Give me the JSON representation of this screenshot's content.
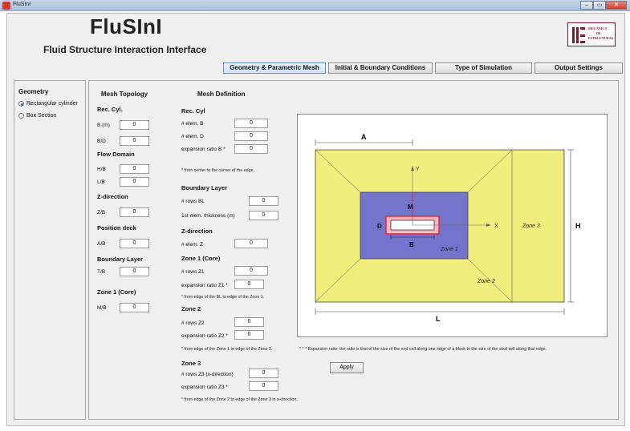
{
  "window": {
    "title": "FluSInI",
    "controls": [
      "–",
      "▭",
      "✕"
    ]
  },
  "header": {
    "title": "FluSInI",
    "subtitle": "Fluid Structure Interaction Interface",
    "logo": {
      "line1": "MECÁNICA",
      "line2": "DE",
      "line3": "ESTRUCTURAS"
    }
  },
  "tabs": [
    {
      "label": "Geometry & Parametric Mesh",
      "active": true
    },
    {
      "label": "Initial & Boundary Conditions",
      "active": false
    },
    {
      "label": "Type of Simulation",
      "active": false
    },
    {
      "label": "Output Settings",
      "active": false
    }
  ],
  "geometry": {
    "title": "Geometry",
    "options": [
      {
        "label": "Rectangular cylinder",
        "selected": true
      },
      {
        "label": "Box Section",
        "selected": false
      }
    ]
  },
  "mesh_topology": {
    "title": "Mesh Topology",
    "rec_cyl": "Rec. Cyl.",
    "b_label": "B (m)",
    "b_value": "0",
    "bd_label": "B/D",
    "bd_value": "0",
    "flow_domain": "Flow Domain",
    "hb_label": "H/B",
    "hb_value": "0",
    "lb_label": "L/B",
    "lb_value": "0",
    "z_direction": "Z-direction",
    "zb_label": "Z/B",
    "zb_value": "0",
    "position_deck": "Position deck",
    "ab_label": "A/B",
    "ab_value": "0",
    "boundary_layer": "Boundary Layer",
    "tb_label": "T/B",
    "tb_value": "0",
    "zone1_core": "Zone 1 (Core)",
    "mb_label": "M/B",
    "mb_value": "0"
  },
  "mesh_definition": {
    "title": "Mesh Definition",
    "rec_cyl": "Rec. Cyl",
    "elem_b_label": "# elem. B",
    "elem_b_value": "0",
    "elem_d_label": "# elem. D",
    "elem_d_value": "0",
    "exp_b_label": "expansion ratio B *",
    "exp_b_value": "0",
    "note_b": "* from center to the corner of the edge.",
    "boundary_layer": "Boundary Layer",
    "rows_bl_label": "# rows BL",
    "rows_bl_value": "0",
    "first_elem_label": "1st elem. thickness (m)",
    "first_elem_value": "0",
    "z_direction": "Z-direction",
    "elem_z_label": "# elem. Z",
    "elem_z_value": "0",
    "zone1": "Zone 1 (Core)",
    "rows_z1_label": "# rows Z1",
    "rows_z1_value": "0",
    "exp_z1_label": "expansion ratio Z1 *",
    "exp_z1_value": "0",
    "note_z1": "* from edge of the BL to edge of the Zone 1.",
    "zone2": "Zone 2",
    "rows_z2_label": "# rows Z2",
    "rows_z2_value": "0",
    "exp_z2_label": "expansion ratio Z2 *",
    "exp_z2_value": "0",
    "note_z2": "* from edge of the Zone 1 to edge of the Zone 2.",
    "zone3": "Zone 3",
    "rows_z3_label": "# rows Z3 (x-direction)",
    "rows_z3_value": "0",
    "exp_z3_label": "expansion ratio Z3 *",
    "exp_z3_value": "0",
    "note_z3": "* from edge of the Zone 2 to edge of the Zone 3 in x-direction."
  },
  "diagram": {
    "labels": {
      "a": "A",
      "h": "H",
      "l": "L",
      "m": "M",
      "d": "D",
      "b": "B",
      "x": "X",
      "y": "Y"
    },
    "zone1": "Zone 1",
    "zone2": "Zone 2",
    "zone3": "Zone 3",
    "colors": {
      "outer": "#f2ee7e",
      "zone1": "#7474cc",
      "deck_border": "#e0243a",
      "bl": "#f6b6c0"
    }
  },
  "expansion_note": "* * * Expansion ratio: the ratio is that of the size of the end cell along one edge of a block to the size of the start cell along that edge.",
  "apply_label": "Apply"
}
